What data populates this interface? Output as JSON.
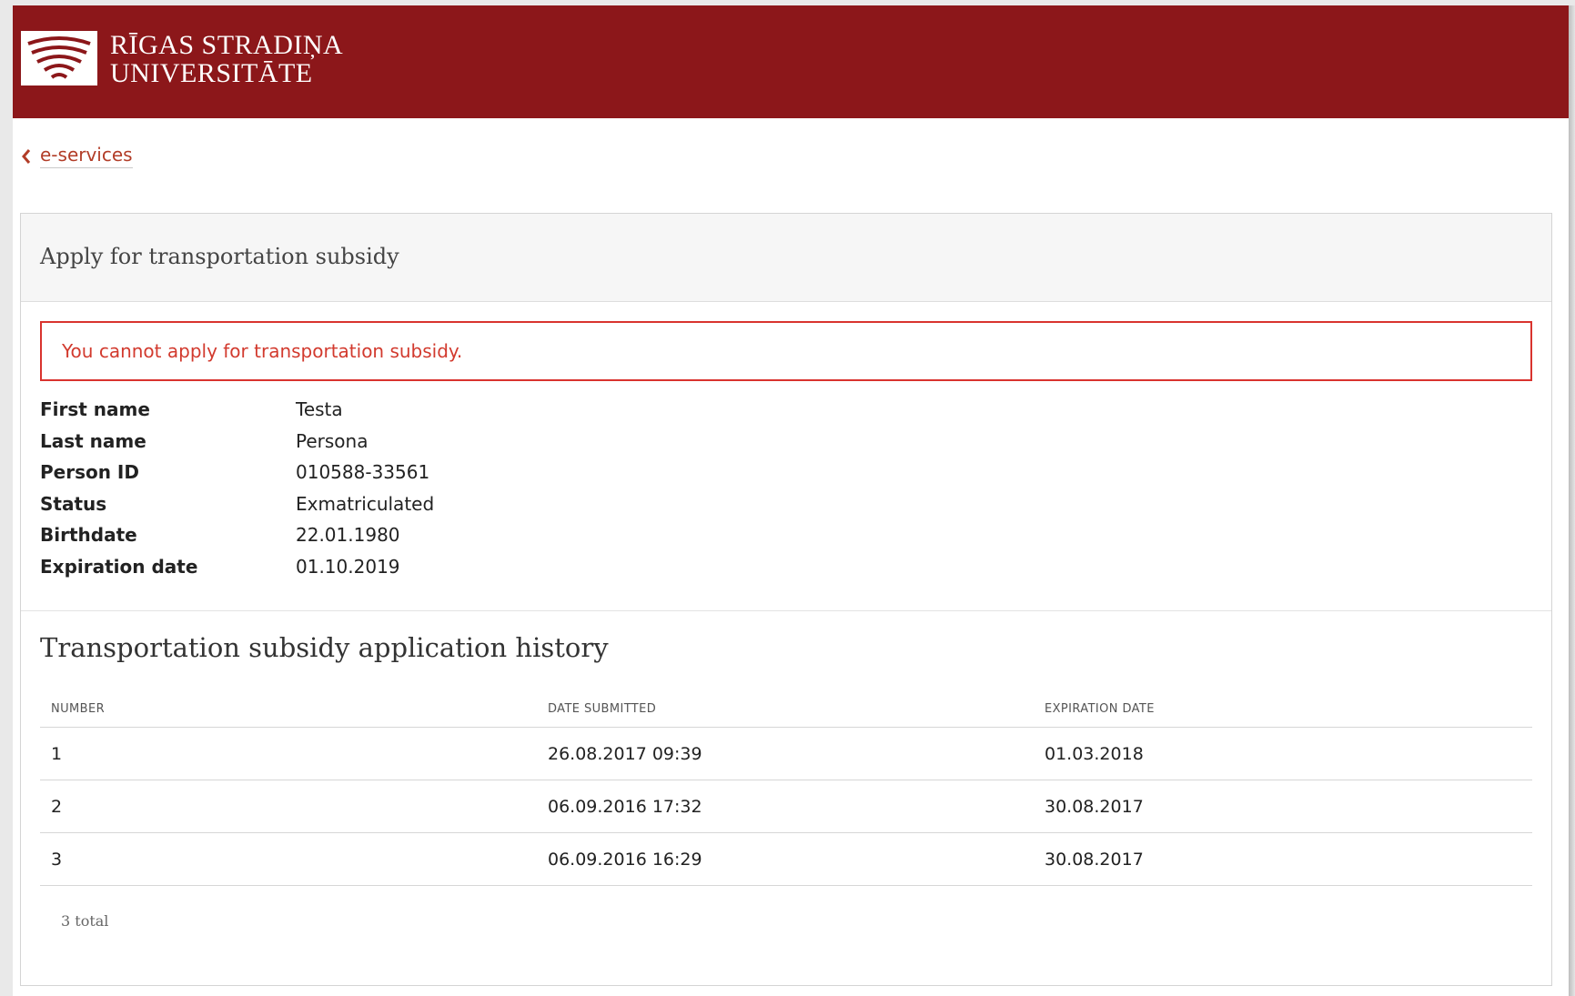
{
  "brand": {
    "line1": "RĪGAS STRADIŅA",
    "line2": "UNIVERSITĀTE",
    "header_color": "#8c171a",
    "logo_icon": "rsu-arches-logo-icon"
  },
  "nav": {
    "back_label": "e-services",
    "back_icon": "chevron-left-icon"
  },
  "panel": {
    "title": "Apply for transportation subsidy",
    "alert": "You cannot apply for transportation subsidy.",
    "alert_color": "#d9332e"
  },
  "info": [
    {
      "label": "First name",
      "value": "Testa"
    },
    {
      "label": "Last name",
      "value": "Persona"
    },
    {
      "label": "Person ID",
      "value": "010588-33561"
    },
    {
      "label": "Status",
      "value": "Exmatriculated"
    },
    {
      "label": "Birthdate",
      "value": "22.01.1980"
    },
    {
      "label": "Expiration date",
      "value": "01.10.2019"
    }
  ],
  "history": {
    "title": "Transportation subsidy application history",
    "columns": [
      "NUMBER",
      "DATE SUBMITTED",
      "EXPIRATION DATE"
    ],
    "rows": [
      [
        "1",
        "26.08.2017 09:39",
        "01.03.2018"
      ],
      [
        "2",
        "06.09.2016 17:32",
        "30.08.2017"
      ],
      [
        "3",
        "06.09.2016 16:29",
        "30.08.2017"
      ]
    ],
    "total": "3 total"
  }
}
